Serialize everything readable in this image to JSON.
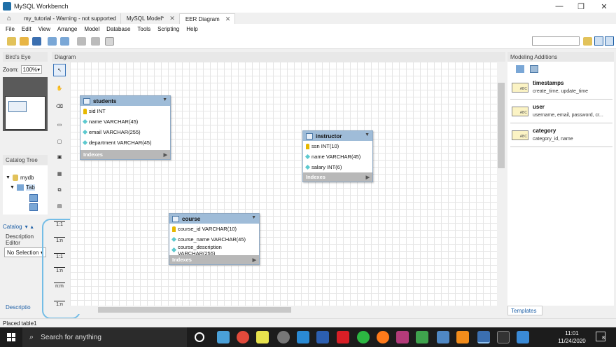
{
  "app": {
    "title": "MySQL Workbench"
  },
  "tabs": [
    {
      "label": "my_tutorial - Warning - not supported"
    },
    {
      "label": "MySQL Model*"
    },
    {
      "label": "EER Diagram"
    }
  ],
  "menu": [
    "File",
    "Edit",
    "View",
    "Arrange",
    "Model",
    "Database",
    "Tools",
    "Scripting",
    "Help"
  ],
  "panels": {
    "birdseye": "Bird's Eye",
    "diagram": "Diagram",
    "catalog_tree": "Catalog Tree",
    "modeling_additions": "Modeling Additions"
  },
  "zoom": {
    "label": "Zoom:",
    "value": "100%"
  },
  "catalog": {
    "db": "mydb",
    "tables_node": "Tab",
    "tab_catalog": "Catalog",
    "desc_editor": "Description Editor",
    "no_selection": "No Selection",
    "bottom_desc": "Descriptio"
  },
  "relationship_tools": [
    "1:1",
    "1:n",
    "1:1",
    "1:n",
    "n:m",
    "1:n"
  ],
  "entities": {
    "students": {
      "name": "students",
      "columns": [
        {
          "text": "sid INT",
          "pk": true
        },
        {
          "text": "name VARCHAR(45)",
          "pk": false
        },
        {
          "text": "email VARCHAR(255)",
          "pk": false
        },
        {
          "text": "department VARCHAR(45)",
          "pk": false
        }
      ],
      "indexes": "Indexes"
    },
    "instructor": {
      "name": "instructor",
      "columns": [
        {
          "text": "ssn INT(10)",
          "pk": true
        },
        {
          "text": "name VARCHAR(45)",
          "pk": false
        },
        {
          "text": "salary INT(6)",
          "pk": false
        }
      ],
      "indexes": "Indexes"
    },
    "course": {
      "name": "course",
      "columns": [
        {
          "text": "course_id VARCHAR(10)",
          "pk": true
        },
        {
          "text": "course_name VARCHAR(45)",
          "pk": false
        },
        {
          "text": "course_description VARCHAR(255)",
          "pk": false
        }
      ],
      "indexes": "Indexes"
    }
  },
  "modeling_additions": [
    {
      "name": "timestamps",
      "columns": "create_time, update_time"
    },
    {
      "name": "user",
      "columns": "username, email, password, cr..."
    },
    {
      "name": "category",
      "columns": "category_id, name"
    }
  ],
  "templates_tab": "Templates",
  "status": "Placed table1",
  "taskbar": {
    "search_placeholder": "Search for anything",
    "time": "11:01",
    "date": "11/24/2020",
    "notifications": "8"
  }
}
